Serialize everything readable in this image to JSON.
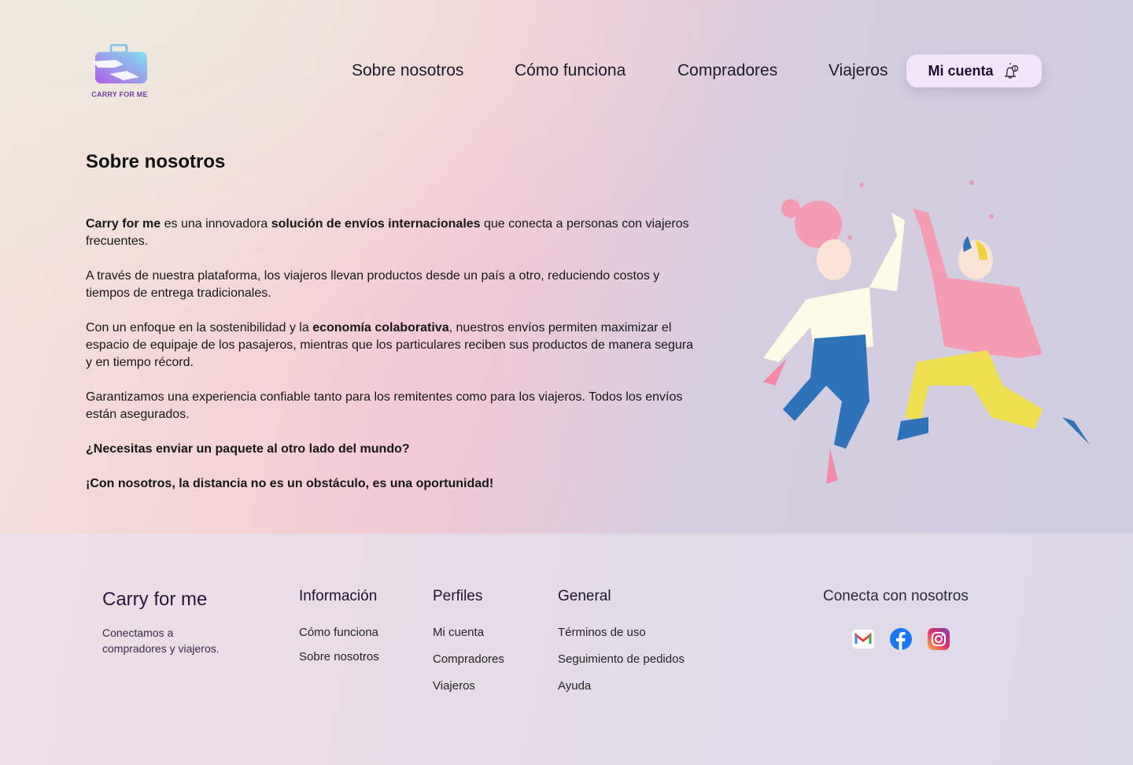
{
  "brand": {
    "logo_text": "CARRY FOR ME"
  },
  "nav": {
    "items": [
      "Sobre nosotros",
      "Cómo funciona",
      "Compradores",
      "Viajeros"
    ],
    "account": "Mi cuenta",
    "notifications": "1"
  },
  "main": {
    "title": "Sobre nosotros",
    "p1": {
      "a": "Carry for me",
      "b": " es una innovadora ",
      "c": "solución de envíos internacionales",
      "d": " que conecta a personas con viajeros frecuentes."
    },
    "p2": "A través de nuestra plataforma, los viajeros llevan productos desde un país a otro, reduciendo costos y tiempos de entrega tradicionales.",
    "p3": {
      "a": "Con un enfoque en la sostenibilidad y la ",
      "b": "economía colaborativa",
      "c": ", nuestros envíos permiten maximizar el espacio de equipaje de los pasajeros, mientras que los particulares reciben sus productos de manera segura y en tiempo récord."
    },
    "p4": "Garantizamos una experiencia confiable tanto para los remitentes como para los viajeros. Todos los envíos están asegurados.",
    "q": "¿Necesitas enviar un paquete al otro lado del mundo?",
    "tagline": "¡Con nosotros, la distancia no es un obstáculo, es una oportunidad!"
  },
  "footer": {
    "brand": "Carry for me",
    "tagline": "Conectamos a compradores y viajeros.",
    "info": {
      "title": "Información",
      "links": [
        "Cómo funciona",
        "Sobre nosotros"
      ]
    },
    "profiles": {
      "title": "Perfiles",
      "links": [
        "Mi cuenta",
        "Compradores",
        "Viajeros"
      ]
    },
    "general": {
      "title": "General",
      "links": [
        "Términos de uso",
        "Seguimiento de pedidos",
        "Ayuda"
      ]
    },
    "connect": {
      "title": "Conecta con nosotros"
    }
  },
  "colors": {
    "accent": "#f3e6fa",
    "brand": "#6b3fa0"
  }
}
